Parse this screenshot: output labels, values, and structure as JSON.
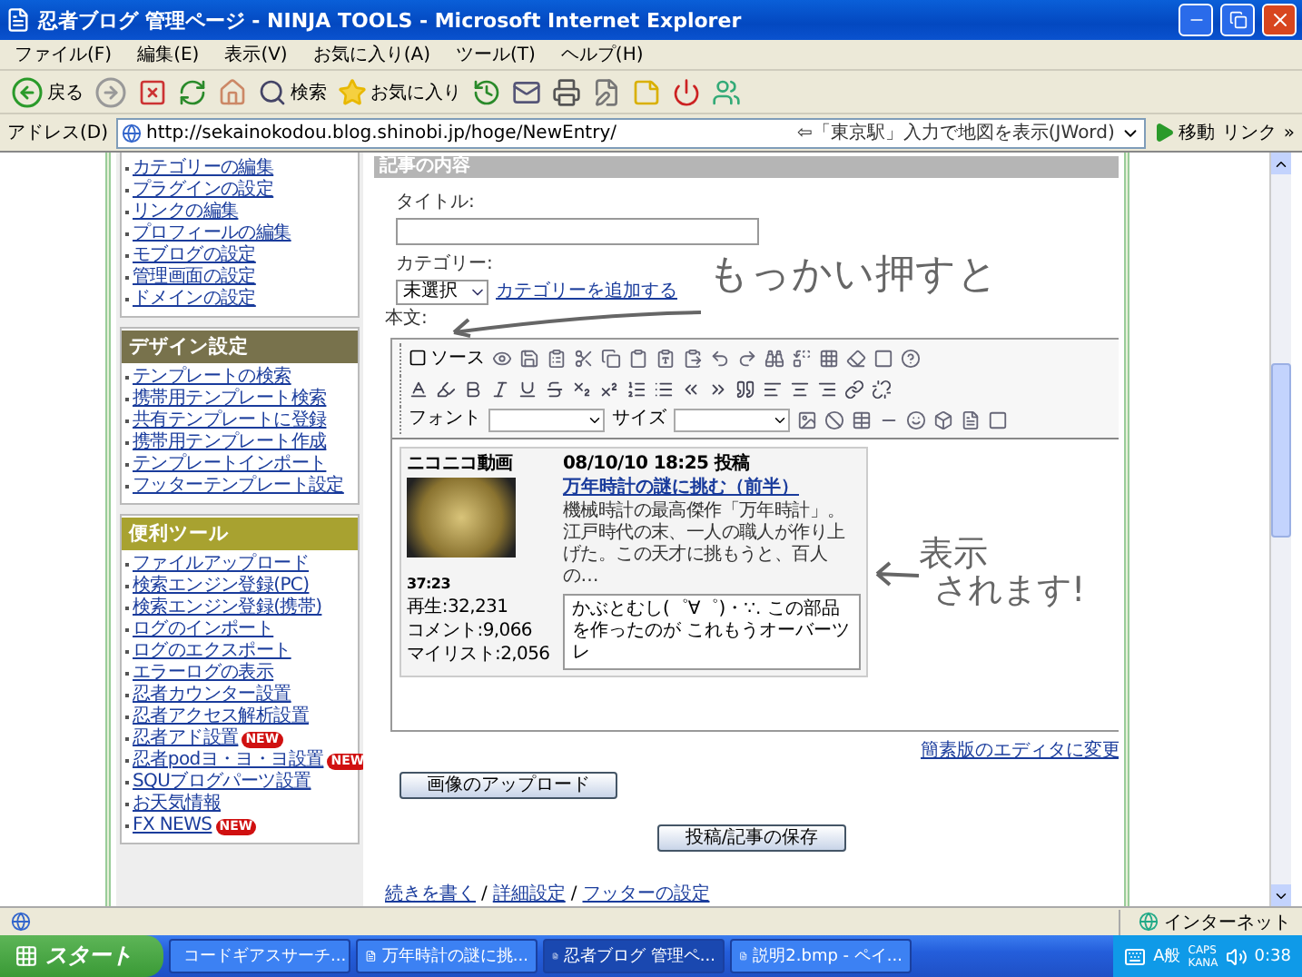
{
  "window": {
    "title": "忍者ブログ 管理ページ - NINJA TOOLS - Microsoft Internet Explorer"
  },
  "menu": [
    "ファイル(F)",
    "編集(E)",
    "表示(V)",
    "お気に入り(A)",
    "ツール(T)",
    "ヘルプ(H)"
  ],
  "toolbar": {
    "back": "戻る",
    "search": "検索",
    "favorites": "お気に入り"
  },
  "address_bar": {
    "label": "アドレス(D)",
    "url": "http://sekainokodou.blog.shinobi.jp/hoge/NewEntry/",
    "hint": "⇦「東京駅」入力で地図を表示(JWord)",
    "go": "移動",
    "links": "リンク",
    "more": "»"
  },
  "sidebar": {
    "sections": [
      {
        "items": [
          {
            "label": "カテゴリーの編集"
          },
          {
            "label": "プラグインの設定"
          },
          {
            "label": "リンクの編集"
          },
          {
            "label": "プロフィールの編集"
          },
          {
            "label": "モブログの設定"
          },
          {
            "label": "管理画面の設定"
          },
          {
            "label": "ドメインの設定"
          }
        ]
      },
      {
        "title": "デザイン設定",
        "color": "#78724c",
        "items": [
          {
            "label": "テンプレートの検索"
          },
          {
            "label": "携帯用テンプレート検索"
          },
          {
            "label": "共有テンプレートに登録"
          },
          {
            "label": "携帯用テンプレート作成"
          },
          {
            "label": "テンプレートインポート"
          },
          {
            "label": "フッターテンプレート設定"
          }
        ]
      },
      {
        "title": "便利ツール",
        "color": "#a8a230",
        "items": [
          {
            "label": "ファイルアップロード"
          },
          {
            "label": "検索エンジン登録(PC)"
          },
          {
            "label": "検索エンジン登録(携帯)"
          },
          {
            "label": "ログのインポート"
          },
          {
            "label": "ログのエクスポート"
          },
          {
            "label": "エラーログの表示"
          },
          {
            "label": "忍者カウンター設置"
          },
          {
            "label": "忍者アクセス解析設置"
          },
          {
            "label": "忍者アド設置",
            "badge": "NEW"
          },
          {
            "label": "忍者podヨ・ヨ・ヨ設置",
            "badge": "NEW"
          },
          {
            "label": "SQUブログパーツ設置"
          },
          {
            "label": "お天気情報"
          },
          {
            "label": "FX NEWS",
            "badge": "NEW"
          }
        ]
      }
    ]
  },
  "main": {
    "section_title": "記事の内容",
    "title_label": "タイトル:",
    "category_label": "カテゴリー:",
    "category_value": "未選択",
    "add_category_link": "カテゴリーを追加する",
    "body_label": "本文:",
    "editor": {
      "source": "ソース",
      "font_label": "フォント",
      "size_label": "サイズ"
    },
    "embed": {
      "site": "ニコニコ動画",
      "posted": "08/10/10 18:25 投稿",
      "title": "万年時計の謎に挑む（前半）",
      "description": "機械時計の最高傑作「万年時計」。江戸時代の末、一人の職人が作り上げた。この天才に挑もうと、百人の…",
      "length": "37:23",
      "stats": [
        "再生:32,231",
        "コメント:9,066",
        "マイリスト:2,056"
      ],
      "comment": "かぶとむし(゜∀゜)・∵. この部品を作ったのが これもうオーバーツレ"
    },
    "simple_editor_link": "簡素版のエディタに変更",
    "upload_button": "画像のアップロード",
    "save_button": "投稿/記事の保存",
    "footer_links": [
      "続きを書く",
      "詳細設定",
      "フッターの設定"
    ],
    "footer_separators": [
      "/",
      "/"
    ]
  },
  "annotations": [
    {
      "lines": [
        "もっかい押すと"
      ]
    },
    {
      "lines": [
        "表示",
        "されます!"
      ]
    }
  ],
  "status_bar": {
    "zone": "インターネット"
  },
  "taskbar": {
    "start": "スタート",
    "tasks": [
      {
        "label": "コードギアスサーチ...",
        "selected": false
      },
      {
        "label": "万年時計の謎に挑...",
        "selected": false
      },
      {
        "label": "忍者ブログ 管理ペ...",
        "selected": true
      },
      {
        "label": "説明2.bmp - ペイ...",
        "selected": false
      }
    ],
    "tray": {
      "ime": "A般",
      "caps": "CAPS",
      "kana": "KANA",
      "clock": "0:38"
    }
  }
}
